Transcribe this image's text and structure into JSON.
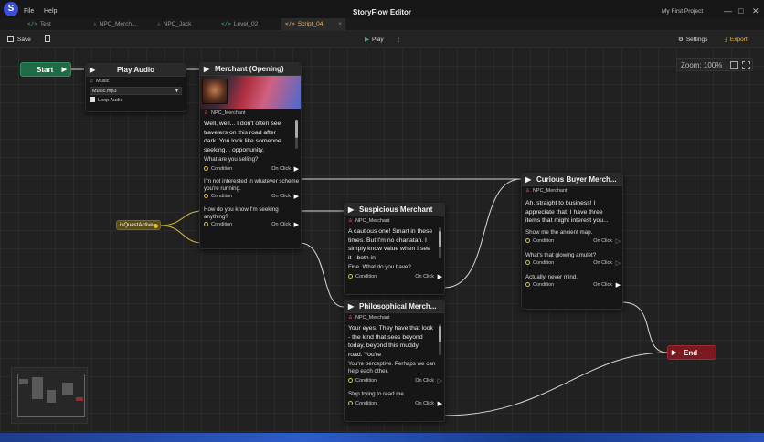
{
  "window": {
    "menu": [
      "File",
      "Help"
    ],
    "title": "StoryFlow Editor",
    "project": "My First Project",
    "controls": [
      "—",
      "□",
      "✕"
    ]
  },
  "tabs": [
    {
      "icon": "</>",
      "label": "Test"
    },
    {
      "icon": "♙",
      "label": "NPC_Merch..."
    },
    {
      "icon": "♙",
      "label": "NPC_Jack"
    },
    {
      "icon": "</>",
      "label": "Level_02"
    },
    {
      "icon": "</>",
      "label": "Script_04",
      "close": "×"
    }
  ],
  "toolbar": {
    "save": "Save",
    "play": "Play",
    "settings": "Settings",
    "export": "Export"
  },
  "canvas": {
    "zoom": "Zoom: 100%"
  },
  "nodes": {
    "start": "Start",
    "end": "End",
    "condition_pill": "isQuestActive",
    "play_audio": {
      "title": "Play Audio",
      "field_label": "Music",
      "file": "Music.mp3",
      "loop": "Loop Audio"
    },
    "merchant": {
      "title": "Merchant (Opening)",
      "owner": "NPC_Merchant",
      "text": "Well, well... I don't often see travelers on this road after dark. You look like someone seeking... opportunity.",
      "choices": [
        "What are you selling?",
        "I'm not interested in whatever scheme you're running.",
        "How do you know I'm seeking anything?"
      ]
    },
    "suspicious": {
      "title": "Suspicious Merchant",
      "owner": "NPC_Merchant",
      "text": "A cautious one! Smart in these times. But I'm no charlatan. I simply know value when I see it - both in",
      "choices": [
        "Fine. What do you have?"
      ]
    },
    "philosophical": {
      "title": "Philosophical Merch...",
      "owner": "NPC_Merchant",
      "text": "Your eyes. They have that look - the kind that sees beyond today, beyond this muddy road. You're",
      "choices": [
        "You're perceptive. Perhaps we can help each other.",
        "Stop trying to read me."
      ]
    },
    "curious": {
      "title": "Curious Buyer Merch...",
      "owner": "NPC_Merchant",
      "text": "Ah, straight to business! I appreciate that. I have three items that might interest you...",
      "choices": [
        "Show me the ancient map.",
        "What's that glowing amulet?",
        "Actually, never mind."
      ]
    }
  },
  "labels": {
    "condition": "Condition",
    "on_click": "On Click"
  },
  "colors": {
    "accent": "#f0b84a",
    "start": "#1f6b45",
    "end": "#8a1f25",
    "pill": "#6b5a1a",
    "wire": "#d7d7d7",
    "cond_wire": "#d8c23a"
  }
}
